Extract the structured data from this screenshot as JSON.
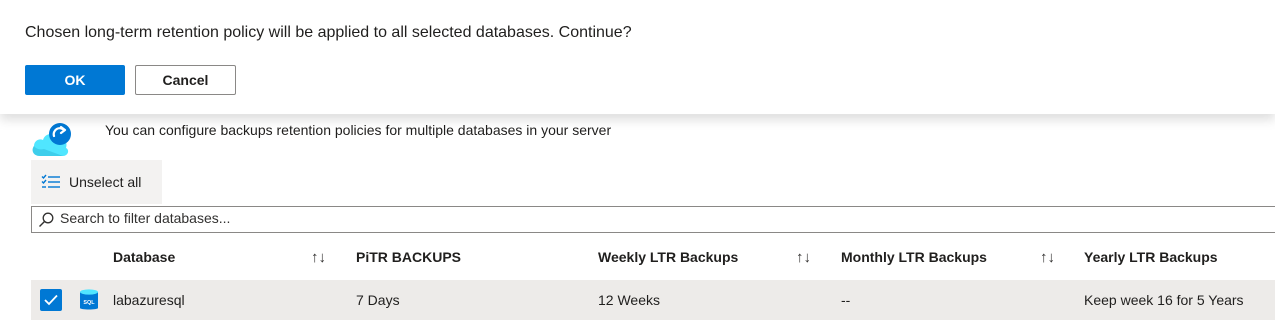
{
  "confirm": {
    "message": "Chosen long-term retention policy will be applied to all selected databases. Continue?",
    "ok_label": "OK",
    "cancel_label": "Cancel"
  },
  "info": {
    "text": "You can configure backups retention policies for multiple databases in your server",
    "icon": "cloud-backup-icon"
  },
  "toolbar": {
    "unselect_label": "Unselect all",
    "unselect_icon": "checklist-icon"
  },
  "search": {
    "placeholder": "Search to filter databases..."
  },
  "table": {
    "columns": [
      "Database",
      "PiTR BACKUPS",
      "Weekly LTR Backups",
      "Monthly LTR Backups",
      "Yearly LTR Backups"
    ],
    "rows": [
      {
        "selected": true,
        "database": "labazuresql",
        "pitr": "7 Days",
        "weekly": "12 Weeks",
        "monthly": "--",
        "yearly": "Keep week 16 for 5 Years"
      }
    ]
  },
  "colors": {
    "accent": "#0078d4",
    "toolbar_bg": "#f3f2f1",
    "row_selected_bg": "#edebe9"
  }
}
